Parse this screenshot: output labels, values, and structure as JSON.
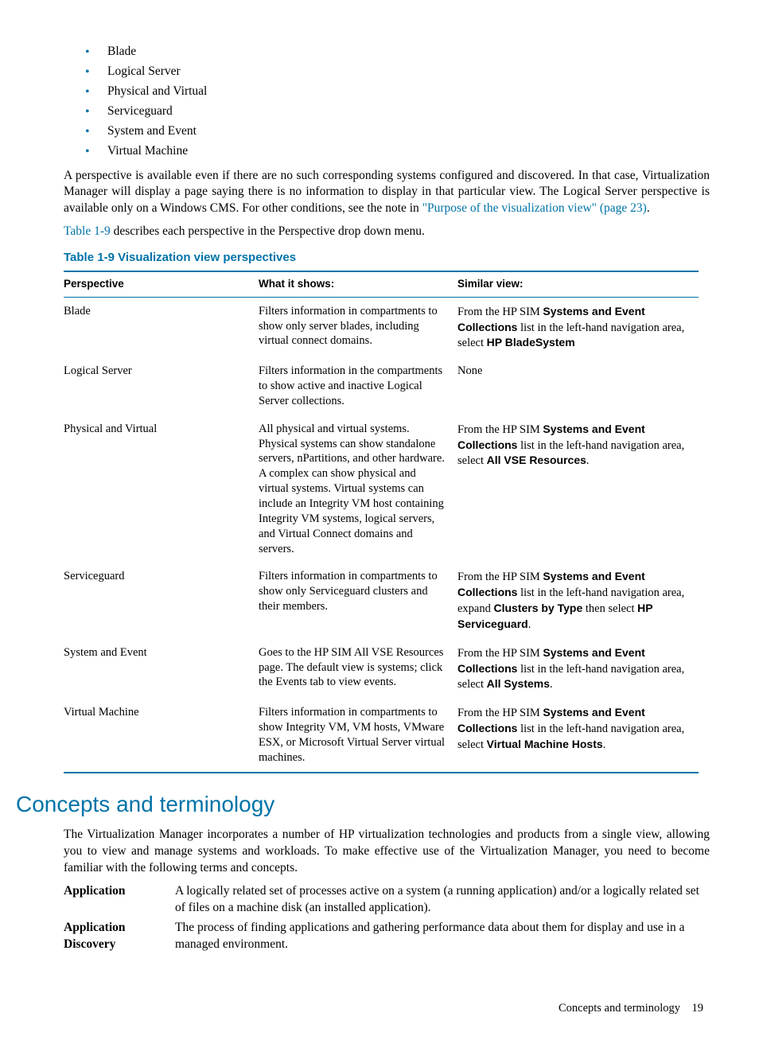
{
  "bullets": [
    "Blade",
    "Logical Server",
    "Physical and Virtual",
    "Serviceguard",
    "System and Event",
    "Virtual Machine"
  ],
  "para1": {
    "pre": "A perspective is available even if there are no such corresponding systems configured and discovered. In that case, Virtualization Manager will display a page saying there is no information to display in that particular view. The Logical Server perspective is available only on a Windows CMS. For other conditions, see the note in ",
    "link": "\"Purpose of the visualization view\" (page 23)",
    "post": "."
  },
  "para2": {
    "link": "Table 1-9",
    "post": " describes each perspective in the Perspective drop down menu."
  },
  "table": {
    "caption": "Table 1-9 Visualization view perspectives",
    "headers": [
      "Perspective",
      "What it shows:",
      "Similar view:"
    ],
    "rows": [
      {
        "p": "Blade",
        "what": "Filters information in compartments to show only server blades, including virtual connect domains.",
        "similar": {
          "pre": "From the HP SIM ",
          "b1": "Systems and Event Collections",
          "mid": " list in the left-hand navigation area, select ",
          "b2": "HP BladeSystem",
          "post": ""
        }
      },
      {
        "p": "Logical Server",
        "what": "Filters information in the compartments to show active and inactive Logical Server collections.",
        "similar": {
          "plain": "None"
        }
      },
      {
        "p": "Physical and Virtual",
        "what": "All physical and virtual systems. Physical systems can show standalone servers, nPartitions, and other hardware. A complex can show physical and virtual systems. Virtual systems can include an Integrity VM host containing Integrity VM systems, logical servers, and Virtual Connect domains and servers.",
        "similar": {
          "pre": "From the HP SIM ",
          "b1": "Systems and Event Collections",
          "mid": " list in the left-hand navigation area, select ",
          "b2": "All VSE Resources",
          "post": "."
        }
      },
      {
        "p": "Serviceguard",
        "what": "Filters information in compartments to show only Serviceguard clusters and their members.",
        "similar": {
          "pre": "From the HP SIM ",
          "b1": "Systems and Event Collections",
          "mid": " list in the left-hand navigation area, expand ",
          "b2": "Clusters by Type",
          "mid2": " then select ",
          "b3": "HP Serviceguard",
          "post": "."
        }
      },
      {
        "p": "System and Event",
        "what": "Goes to the HP SIM All VSE Resources page. The default view is systems; click the Events tab to view events.",
        "similar": {
          "pre": "From the HP SIM ",
          "b1": "Systems and Event Collections",
          "mid": " list in the left-hand navigation area, select ",
          "b2": "All Systems",
          "post": "."
        }
      },
      {
        "p": "Virtual Machine",
        "what": "Filters information in compartments to show Integrity VM, VM hosts, VMware ESX, or Microsoft Virtual Server virtual machines.",
        "similar": {
          "pre": "From the HP SIM ",
          "b1": "Systems and Event Collections",
          "mid": " list in the left-hand navigation area, select ",
          "b2": "Virtual Machine Hosts",
          "post": "."
        }
      }
    ]
  },
  "section": {
    "heading": "Concepts and terminology",
    "intro": "The Virtualization Manager incorporates a number of HP virtualization technologies and products from a single view, allowing you to view and manage systems and workloads. To make effective use of the Virtualization Manager, you need to become familiar with the following terms and concepts.",
    "defs": [
      {
        "term": "Application",
        "desc": "A logically related set of processes active on a system (a running application) and/or a logically related set of files on a machine disk (an installed application)."
      },
      {
        "term": "Application Discovery",
        "desc": "The process of finding applications and gathering performance data about them for display and use in a managed environment."
      }
    ]
  },
  "footer": {
    "text": "Concepts and terminology",
    "page": "19"
  }
}
